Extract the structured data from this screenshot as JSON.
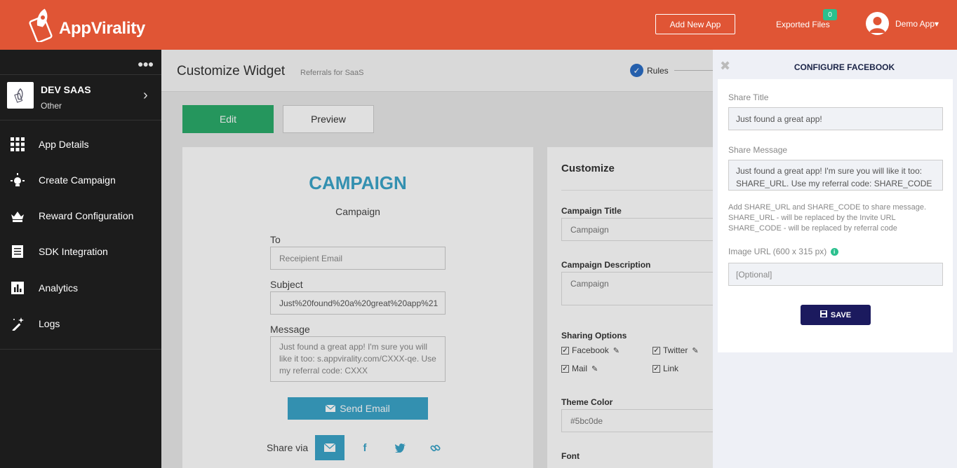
{
  "header": {
    "brand": "AppVirality",
    "add_app_label": "Add New App",
    "exported_label": "Exported Files",
    "exported_count": "0",
    "user_label": "Demo App▾"
  },
  "sidebar": {
    "app_name": "DEV SAAS",
    "app_type": "Other",
    "items": [
      {
        "label": "App Details",
        "icon": "grid-icon"
      },
      {
        "label": "Create Campaign",
        "icon": "bulb-icon"
      },
      {
        "label": "Reward Configuration",
        "icon": "crown-icon"
      },
      {
        "label": "SDK Integration",
        "icon": "receipt-icon"
      },
      {
        "label": "Analytics",
        "icon": "bar-chart-icon"
      },
      {
        "label": "Logs",
        "icon": "magic-wand-icon"
      }
    ]
  },
  "main": {
    "title": "Customize Widget",
    "subtitle": "Referrals for SaaS",
    "step_label": "Rules",
    "tab_edit": "Edit",
    "tab_preview": "Preview"
  },
  "widget": {
    "title": "CAMPAIGN",
    "subtitle": "Campaign",
    "to_label": "To",
    "to_placeholder": "Receipient Email",
    "subject_label": "Subject",
    "subject_value": "Just%20found%20a%20great%20app%21",
    "message_label": "Message",
    "message_value": "Just found a great app! I'm sure you will like it too: s.appvirality.com/CXXX-qe. Use my referral code: CXXX",
    "send_label": "Send Email",
    "share_label": "Share via"
  },
  "customize": {
    "title": "Customize",
    "campaign_title_label": "Campaign Title",
    "campaign_title_value": "Campaign",
    "campaign_desc_label": "Campaign Description",
    "campaign_desc_value": "Campaign",
    "sharing_label": "Sharing Options",
    "options": [
      {
        "label": "Facebook",
        "checked": true
      },
      {
        "label": "Twitter",
        "checked": true
      },
      {
        "label": "Mail",
        "checked": true
      },
      {
        "label": "Link",
        "checked": true
      }
    ],
    "theme_label": "Theme Color",
    "theme_value": "#5bc0de",
    "font_label": "Font"
  },
  "panel": {
    "title": "CONFIGURE FACEBOOK",
    "share_title_label": "Share Title",
    "share_title_value": "Just found a great app!",
    "share_message_label": "Share Message",
    "share_message_value": "Just found a great app! I'm sure you will like it too: SHARE_URL. Use my referral code: SHARE_CODE",
    "help_line1": "Add SHARE_URL and SHARE_CODE to share message.",
    "help_line2": "SHARE_URL - will be replaced by the Invite URL",
    "help_line3": "SHARE_CODE - will be replaced by referral code",
    "image_url_label": "Image URL (600 x 315 px)",
    "image_url_placeholder": "[Optional]",
    "save_label": "SAVE"
  },
  "colors": {
    "header_bg": "#e05535",
    "sidebar_bg": "#1c1c1c",
    "edit_green": "#2bab6a",
    "campaign_blue": "#3ba4c9",
    "save_navy": "#1b1a5e",
    "badge_green": "#2bc08e"
  }
}
